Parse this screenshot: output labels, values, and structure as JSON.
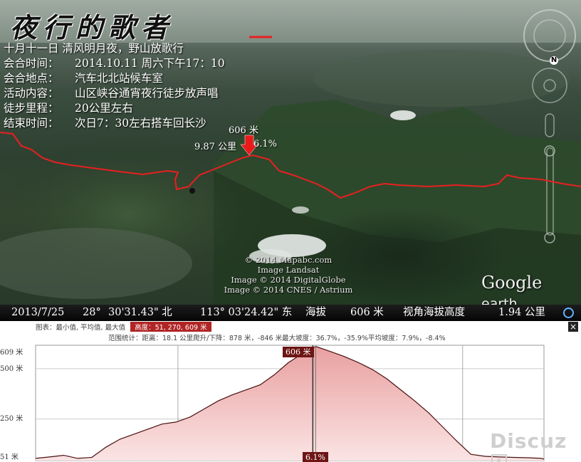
{
  "overlay": {
    "title": "夜行的歌者",
    "lines": [
      {
        "label": "",
        "value": "十月十一日 清风明月夜，野山放歌行"
      },
      {
        "label": "会合时间：",
        "value": "2014.10.11 周六下午17：10"
      },
      {
        "label": "会合地点：",
        "value": "汽车北北站候车室"
      },
      {
        "label": "活动内容：",
        "value": "山区峡谷通宵夜行徒步放声唱"
      },
      {
        "label": "徒步里程：",
        "value": "20公里左右"
      },
      {
        "label": "结束时间：",
        "value": "次日7：30左右搭车回长沙"
      }
    ]
  },
  "pin": {
    "elevation": "606 米",
    "distance": "9.87 公里",
    "slope": "6.1%"
  },
  "credits": [
    "© 2014 Mapabc.com",
    "Image Landsat",
    "Image © 2014 DigitalGlobe",
    "Image © 2014 CNES / Astrium"
  ],
  "brand": {
    "google": "Google",
    "earth": "earth"
  },
  "nav": {
    "compass_letter": "N"
  },
  "status": {
    "date": "2013/7/25",
    "lat_deg": "28°",
    "lat_min": "30'31.43\" 北",
    "lon": "113° 03'24.42\" 东",
    "elev_label": "海拔",
    "elev_value": "606 米",
    "eye_label": "视角海拔高度",
    "eye_value": "1.94 公里"
  },
  "profile": {
    "header_prefix": "图表：最小值, 平均值, 最大值",
    "header_highlight": "高度：51, 270, 609 米",
    "stats": "范围统计：距离：18.1 公里爬升/下降：878 米，-846 米最大坡度：36.7%，-35.9%平均坡度：7.9%，-8.4%",
    "y_labels": [
      "609 米",
      "500 米",
      "250 米",
      "51 米"
    ],
    "marker_top": "606 米",
    "marker_bottom": "6.1%",
    "close": "×"
  },
  "watermark": {
    "text": "Discuz",
    "bang": "!"
  },
  "chart_data": {
    "type": "area",
    "title": "",
    "xlabel": "",
    "ylabel": "",
    "x": [
      0,
      0.5,
      1,
      1.5,
      2,
      2.5,
      3,
      3.5,
      4,
      4.5,
      5,
      5.5,
      6,
      6.5,
      7,
      7.5,
      8,
      8.5,
      9,
      9.5,
      9.87,
      10,
      10.5,
      11,
      11.5,
      12,
      12.5,
      13,
      13.5,
      14,
      14.5,
      15,
      15.5,
      16,
      16.5,
      17,
      17.5,
      18,
      18.1
    ],
    "series": [
      {
        "values": [
          55,
          62,
          70,
          55,
          60,
          110,
          150,
          175,
          200,
          225,
          235,
          260,
          300,
          340,
          370,
          395,
          420,
          470,
          530,
          575,
          606,
          609,
          585,
          560,
          530,
          495,
          450,
          395,
          340,
          280,
          210,
          140,
          75,
          65,
          62,
          60,
          58,
          55,
          51
        ]
      }
    ],
    "ylim": [
      51,
      609
    ],
    "xlim": [
      0,
      18.1
    ]
  }
}
